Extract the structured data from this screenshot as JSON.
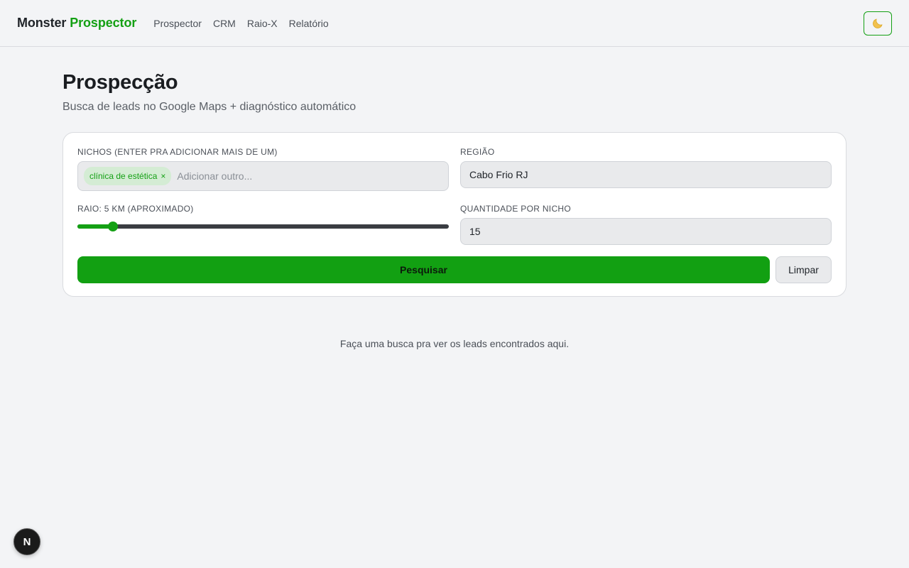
{
  "header": {
    "brand_primary": "Monster",
    "brand_accent": "Prospector",
    "nav": [
      {
        "label": "Prospector"
      },
      {
        "label": "CRM"
      },
      {
        "label": "Raio-X"
      },
      {
        "label": "Relatório"
      }
    ],
    "theme_icon": "moon-icon"
  },
  "page": {
    "title": "Prospecção",
    "subtitle": "Busca de leads no Google Maps + diagnóstico automático"
  },
  "form": {
    "nichos": {
      "label": "NICHOS (ENTER PRA ADICIONAR MAIS DE UM)",
      "tags": [
        "clínica de estética"
      ],
      "tag_remove": "×",
      "placeholder": "Adicionar outro..."
    },
    "regiao": {
      "label": "REGIÃO",
      "value": "Cabo Frio RJ"
    },
    "raio": {
      "label": "RAIO: 5 KM (APROXIMADO)",
      "value_fraction": 0.095
    },
    "quantidade": {
      "label": "QUANTIDADE POR NICHO",
      "value": "15"
    },
    "search_label": "Pesquisar",
    "clear_label": "Limpar"
  },
  "empty_state": "Faça uma busca pra ver os leads encontrados aqui.",
  "dev_badge": "N",
  "colors": {
    "accent": "#14a014",
    "background": "#f3f4f6"
  }
}
